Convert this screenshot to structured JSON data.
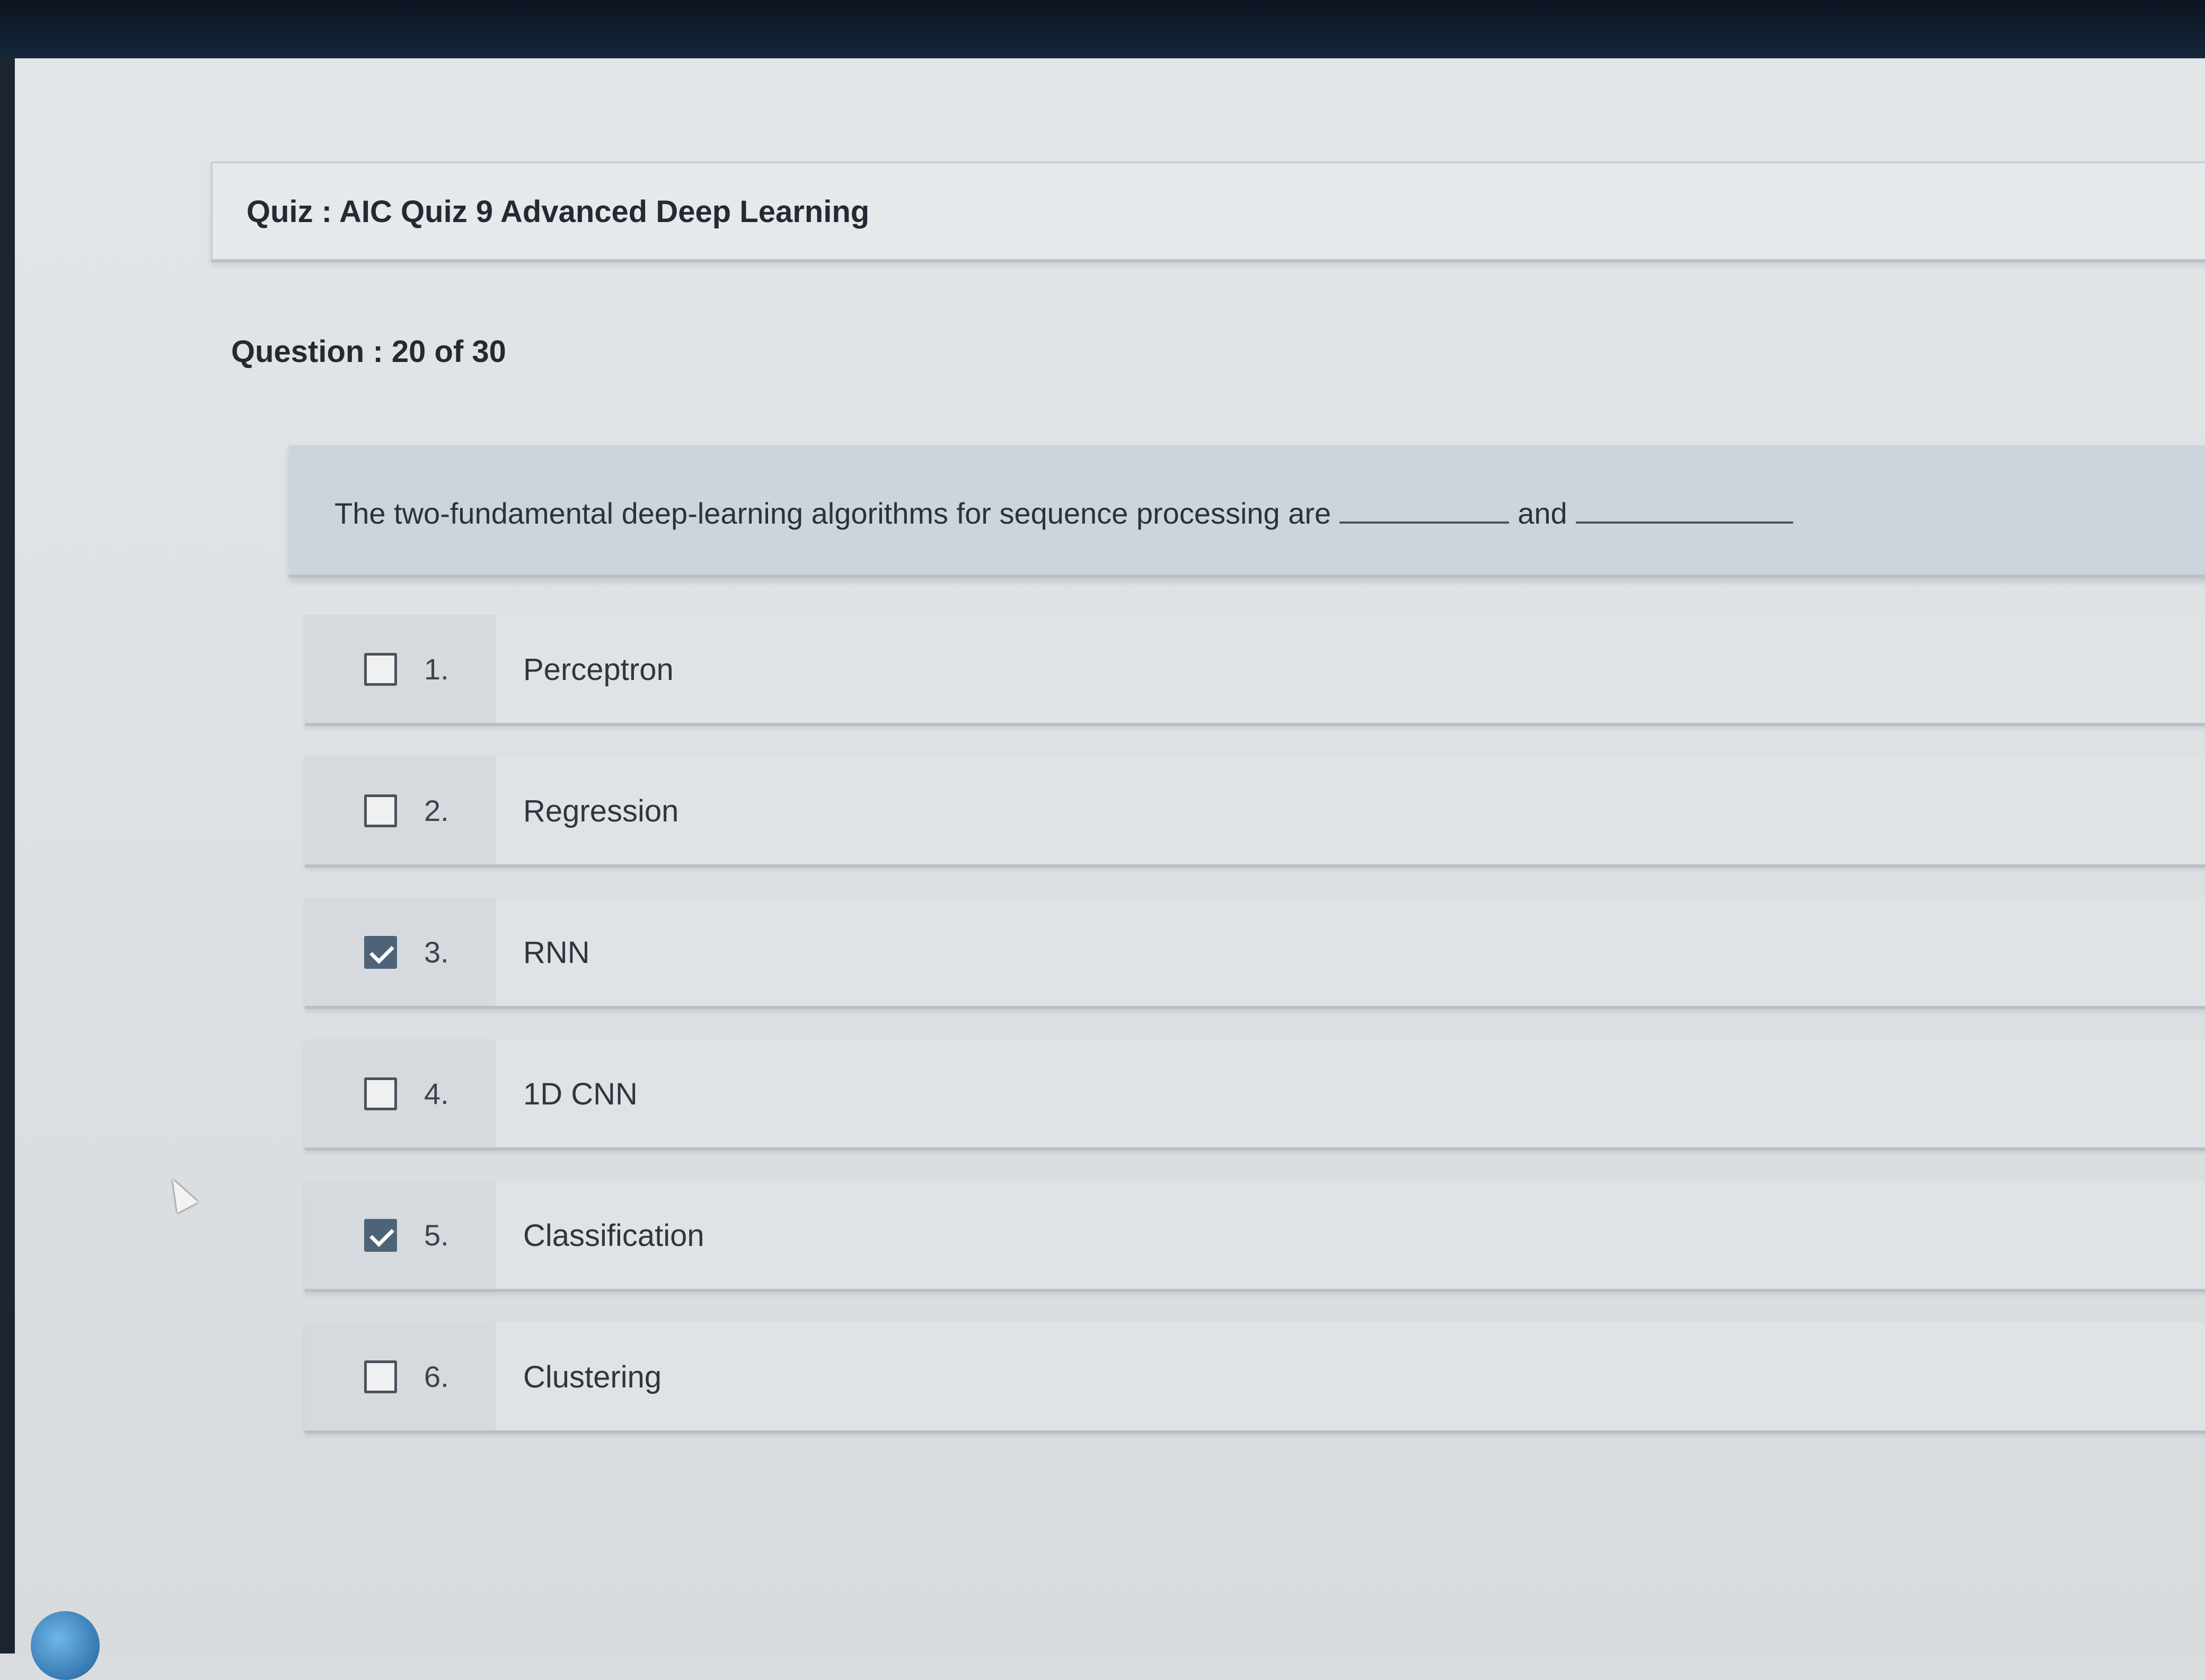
{
  "quiz": {
    "title": "Quiz : AIC Quiz 9 Advanced Deep Learning",
    "counter": "Question : 20 of 30"
  },
  "question": {
    "text_before": "The two-fundamental deep-learning algorithms for sequence processing are",
    "text_middle": "and"
  },
  "options": [
    {
      "number": "1.",
      "label": "Perceptron",
      "checked": false
    },
    {
      "number": "2.",
      "label": "Regression",
      "checked": false
    },
    {
      "number": "3.",
      "label": "RNN",
      "checked": true
    },
    {
      "number": "4.",
      "label": "1D CNN",
      "checked": false
    },
    {
      "number": "5.",
      "label": "Classification",
      "checked": true
    },
    {
      "number": "6.",
      "label": "Clustering",
      "checked": false
    }
  ],
  "colors": {
    "checked_fill": "#4d6478",
    "page_background": "#d9dde0"
  }
}
